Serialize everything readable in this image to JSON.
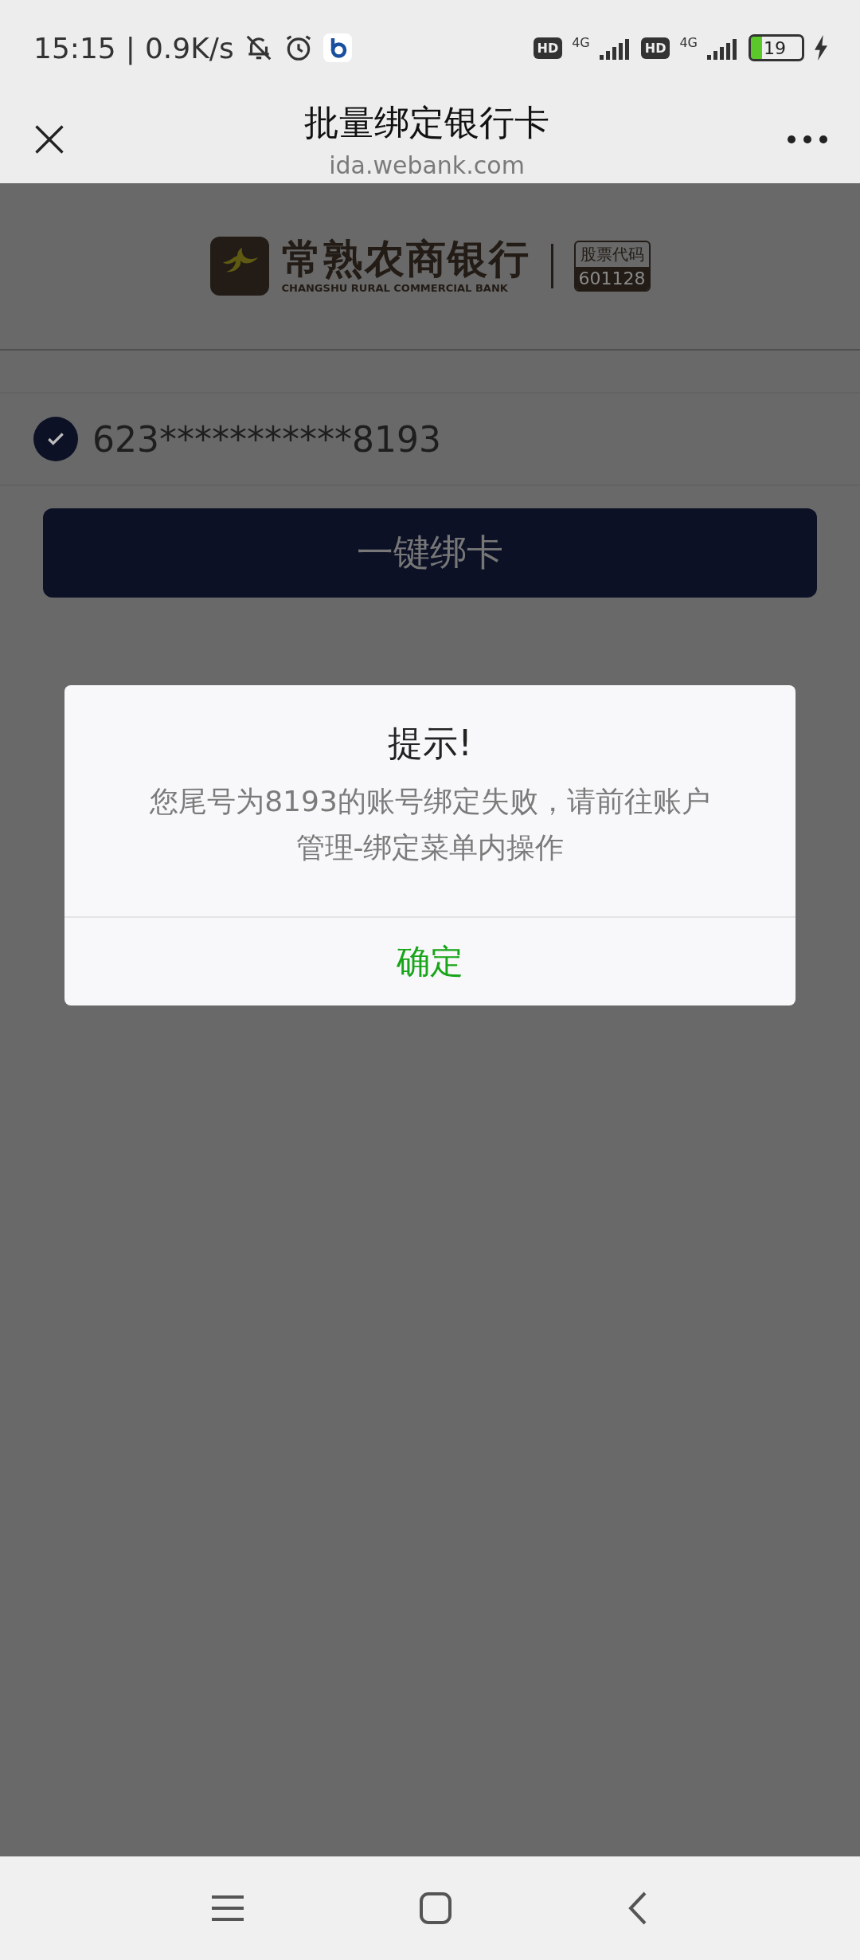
{
  "status_bar": {
    "time": "15:15",
    "separator": "|",
    "speed": "0.9K/s",
    "sims": [
      {
        "hd": "HD",
        "network": "4G"
      },
      {
        "hd": "HD",
        "network": "4G"
      }
    ],
    "battery": "19"
  },
  "header": {
    "title": "批量绑定银行卡",
    "url": "ida.webank.com"
  },
  "bank_logo": {
    "name": "常熟农商银行",
    "english": "CHANGSHU RURAL COMMERCIAL BANK",
    "stock_label": "股票代码",
    "stock_code": "601128"
  },
  "accounts": [
    {
      "number": "623***********8193",
      "checked": true
    }
  ],
  "bind_button": {
    "label": "一键绑卡"
  },
  "dialog": {
    "title": "提示!",
    "message": "您尾号为8193的账号绑定失败，请前往账户管理-绑定菜单内操作",
    "confirm": "确定"
  }
}
